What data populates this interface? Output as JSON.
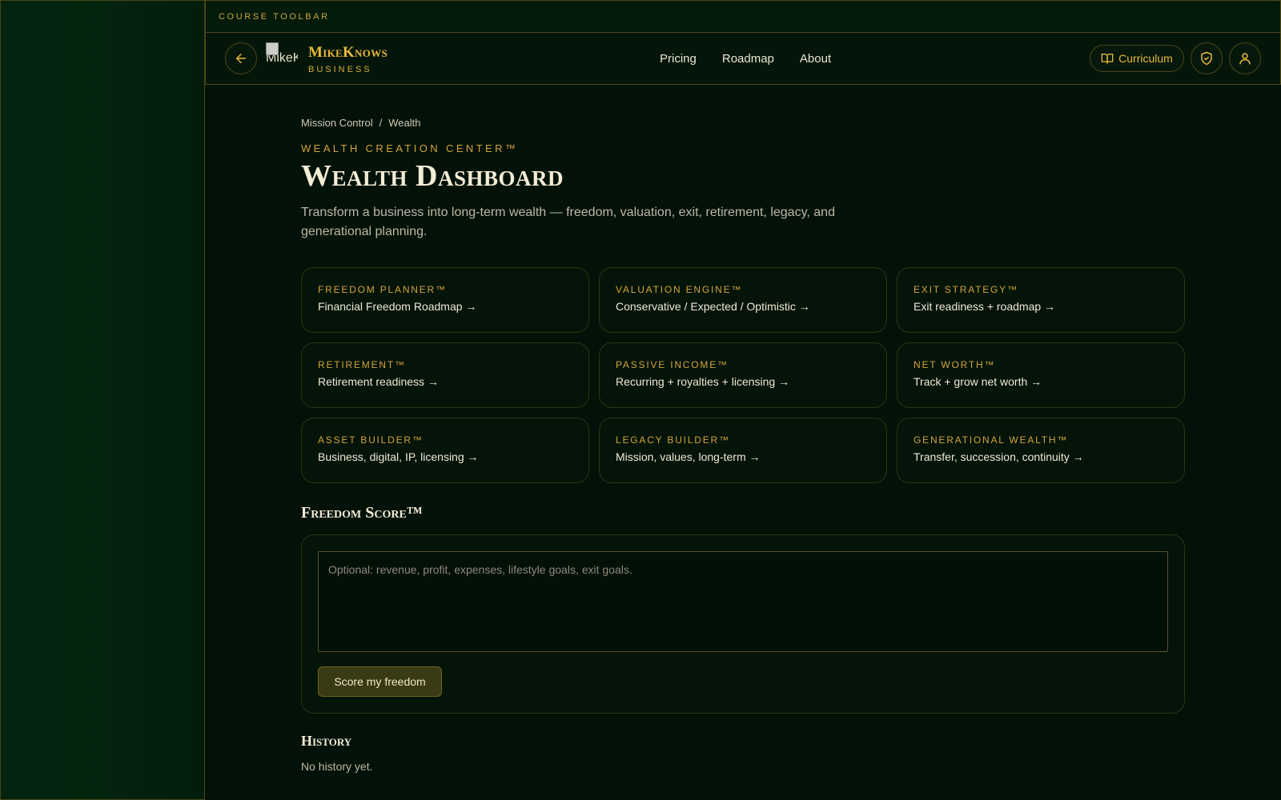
{
  "toolbar": {
    "label": "COURSE TOOLBAR"
  },
  "header": {
    "logo_alt": "MikeKnows",
    "brand_name": "MikeKnows",
    "brand_sub": "BUSINESS",
    "nav": [
      "Pricing",
      "Roadmap",
      "About"
    ],
    "curriculum_label": "Curriculum",
    "icons": [
      "arrow-left-icon",
      "book-icon",
      "shield-check-icon",
      "user-icon"
    ]
  },
  "breadcrumb": {
    "root": "Mission Control",
    "separator": "/",
    "current": "Wealth"
  },
  "page": {
    "eyebrow": "WEALTH CREATION CENTER™",
    "title": "Wealth Dashboard",
    "description": "Transform a business into long-term wealth — freedom, valuation, exit, retirement, legacy, and generational planning."
  },
  "cards": [
    {
      "title": "FREEDOM PLANNER™",
      "subtitle": "Financial Freedom Roadmap →"
    },
    {
      "title": "VALUATION ENGINE™",
      "subtitle": "Conservative / Expected / Optimistic →"
    },
    {
      "title": "EXIT STRATEGY™",
      "subtitle": "Exit readiness + roadmap →"
    },
    {
      "title": "RETIREMENT™",
      "subtitle": "Retirement readiness →"
    },
    {
      "title": "PASSIVE INCOME™",
      "subtitle": "Recurring + royalties + licensing →"
    },
    {
      "title": "NET WORTH™",
      "subtitle": "Track + grow net worth →"
    },
    {
      "title": "ASSET BUILDER™",
      "subtitle": "Business, digital, IP, licensing →"
    },
    {
      "title": "LEGACY BUILDER™",
      "subtitle": "Mission, values, long-term →"
    },
    {
      "title": "GENERATIONAL WEALTH™",
      "subtitle": "Transfer, succession, continuity →"
    }
  ],
  "freedom_score": {
    "title": "Freedom Score™",
    "input_value": "",
    "placeholder": "Optional: revenue, profit, expenses, lifestyle goals, exit goals.",
    "button_label": "Score my freedom"
  },
  "history": {
    "title": "History",
    "empty_text": "No history yet."
  },
  "colors": {
    "accent": "#e9b93c",
    "background": "#031208",
    "border": "#4f4914"
  }
}
